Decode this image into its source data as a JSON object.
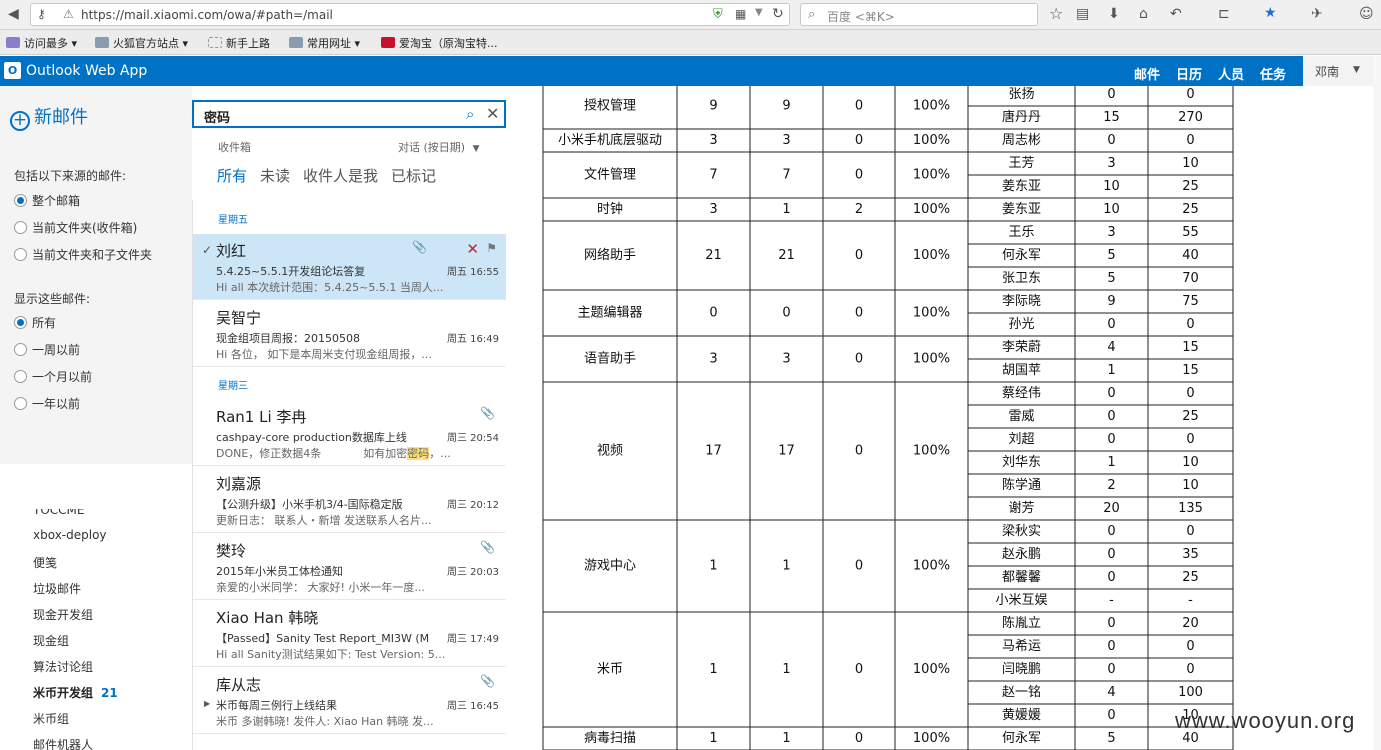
{
  "browser": {
    "url": "https://mail.xiaomi.com/owa/#path=/mail",
    "search_placeholder": "百度 <⌘K>"
  },
  "bookmarks": [
    "访问最多",
    "火狐官方站点",
    "新手上路",
    "常用网址",
    "爱淘宝（原淘宝特..."
  ],
  "header": {
    "app_title": "Outlook Web App",
    "logo_letter": "O",
    "nav": [
      "邮件",
      "日历",
      "人员",
      "任务"
    ],
    "user": "邓南"
  },
  "left": {
    "new_mail": "新邮件",
    "include_label": "包括以下来源的邮件:",
    "include_options": [
      {
        "label": "整个邮箱",
        "checked": true
      },
      {
        "label": "当前文件夹(收件箱)",
        "checked": false
      },
      {
        "label": "当前文件夹和子文件夹",
        "checked": false
      }
    ],
    "show_label": "显示这些邮件:",
    "show_options": [
      {
        "label": "所有",
        "checked": true
      },
      {
        "label": "一周以前",
        "checked": false
      },
      {
        "label": "一个月以前",
        "checked": false
      },
      {
        "label": "一年以前",
        "checked": false
      }
    ],
    "folders": [
      {
        "name": "TOCCME",
        "count": "",
        "bold": false
      },
      {
        "name": "xbox-deploy",
        "count": "",
        "bold": false
      },
      {
        "name": "便笺",
        "count": "",
        "bold": false
      },
      {
        "name": "垃圾邮件",
        "count": "",
        "bold": false
      },
      {
        "name": "现金开发组",
        "count": "",
        "bold": false
      },
      {
        "name": "现金组",
        "count": "",
        "bold": false
      },
      {
        "name": "算法讨论组",
        "count": "",
        "bold": false
      },
      {
        "name": "米币开发组",
        "count": "21",
        "bold": true
      },
      {
        "name": "米币组",
        "count": "",
        "bold": false
      },
      {
        "name": "邮件机器人",
        "count": "",
        "bold": false
      }
    ]
  },
  "search": {
    "query": "密码",
    "folder": "收件箱",
    "sort": "对话 (按日期)",
    "tabs": [
      "所有",
      "未读",
      "收件人是我",
      "已标记"
    ]
  },
  "messages": {
    "day1": "星期五",
    "day2": "星期三",
    "items": [
      {
        "sender": "刘红",
        "subject": "5.4.25~5.5.1开发组论坛答复",
        "time": "周五 16:55",
        "preview": "Hi all 本次统计范围：5.4.25~5.5.1 当周人..."
      },
      {
        "sender": "吴智宁",
        "subject": "现金组项目周报：20150508",
        "time": "周五 16:49",
        "preview": "Hi 各位，    如下是本周米支付现金组周报，..."
      },
      {
        "sender": "Ran1 Li 李冉",
        "subject": "cashpay-core production数据库上线",
        "time": "周三 20:54",
        "preview_a": "DONE，修正数据4条            如有加密",
        "preview_hl": "密码",
        "preview_b": "，..."
      },
      {
        "sender": "刘嘉源",
        "subject": "【公测升级】小米手机3/4-国际稳定版",
        "time": "周三 20:12",
        "preview": "更新日志：  联系人・新增 发送联系人名片..."
      },
      {
        "sender": "樊玲",
        "subject": "2015年小米员工体检通知",
        "time": "周三 20:03",
        "preview": "亲爱的小米同学：  大家好!  小米一年一度..."
      },
      {
        "sender": "Xiao Han 韩晓",
        "subject": "【Passed】Sanity Test Report_MI3W (M",
        "time": "周三 17:49",
        "preview": "Hi all Sanity测试结果如下:  Test Version:  5..."
      },
      {
        "sender": "库从志",
        "subject": "米币每周三例行上线结果",
        "time": "周三 16:45",
        "preview": "米币 多谢韩晓!  发件人: Xiao Han 韩晓 发..."
      }
    ]
  },
  "table": {
    "groups": [
      {
        "name": "授权管理",
        "a": "9",
        "b": "9",
        "c": "0",
        "pct": "100%",
        "rows": [
          [
            "张扬",
            "0",
            "0"
          ],
          [
            "唐丹丹",
            "15",
            "270"
          ]
        ]
      },
      {
        "name": "小米手机底层驱动",
        "a": "3",
        "b": "3",
        "c": "0",
        "pct": "100%",
        "rows": [
          [
            "周志彬",
            "0",
            "0"
          ]
        ]
      },
      {
        "name": "文件管理",
        "a": "7",
        "b": "7",
        "c": "0",
        "pct": "100%",
        "rows": [
          [
            "王芳",
            "3",
            "10"
          ],
          [
            "姜东亚",
            "10",
            "25"
          ]
        ]
      },
      {
        "name": "时钟",
        "a": "3",
        "b": "1",
        "c": "2",
        "pct": "100%",
        "rows": [
          [
            "姜东亚",
            "10",
            "25"
          ]
        ]
      },
      {
        "name": "网络助手",
        "a": "21",
        "b": "21",
        "c": "0",
        "pct": "100%",
        "rows": [
          [
            "王乐",
            "3",
            "55"
          ],
          [
            "何永军",
            "5",
            "40"
          ],
          [
            "张卫东",
            "5",
            "70"
          ]
        ]
      },
      {
        "name": "主题编辑器",
        "a": "0",
        "b": "0",
        "c": "0",
        "pct": "100%",
        "rows": [
          [
            "李际晓",
            "9",
            "75"
          ],
          [
            "孙光",
            "0",
            "0"
          ]
        ]
      },
      {
        "name": "语音助手",
        "a": "3",
        "b": "3",
        "c": "0",
        "pct": "100%",
        "rows": [
          [
            "李荣蔚",
            "4",
            "15"
          ],
          [
            "胡国苹",
            "1",
            "15"
          ]
        ]
      },
      {
        "name": "视频",
        "a": "17",
        "b": "17",
        "c": "0",
        "pct": "100%",
        "rows": [
          [
            "蔡经伟",
            "0",
            "0"
          ],
          [
            "雷威",
            "0",
            "25"
          ],
          [
            "刘超",
            "0",
            "0"
          ],
          [
            "刘华东",
            "1",
            "10"
          ],
          [
            "陈学通",
            "2",
            "10"
          ],
          [
            "谢芳",
            "20",
            "135"
          ]
        ]
      },
      {
        "name": "游戏中心",
        "a": "1",
        "b": "1",
        "c": "0",
        "pct": "100%",
        "rows": [
          [
            "梁秋实",
            "0",
            "0"
          ],
          [
            "赵永鹏",
            "0",
            "35"
          ],
          [
            "都馨馨",
            "0",
            "25"
          ],
          [
            "小米互娱",
            "-",
            "-"
          ]
        ]
      },
      {
        "name": "米币",
        "a": "1",
        "b": "1",
        "c": "0",
        "pct": "100%",
        "rows": [
          [
            "陈胤立",
            "0",
            "20"
          ],
          [
            "马希运",
            "0",
            "0"
          ],
          [
            "闫晓鹏",
            "0",
            "0"
          ],
          [
            "赵一铭",
            "4",
            "100"
          ],
          [
            "黄媛媛",
            "0",
            "10"
          ]
        ]
      },
      {
        "name": "病毒扫描",
        "a": "1",
        "b": "1",
        "c": "0",
        "pct": "100%",
        "rows": [
          [
            "何永军",
            "5",
            "40"
          ]
        ]
      }
    ]
  },
  "watermark": "www.wooyun.org"
}
